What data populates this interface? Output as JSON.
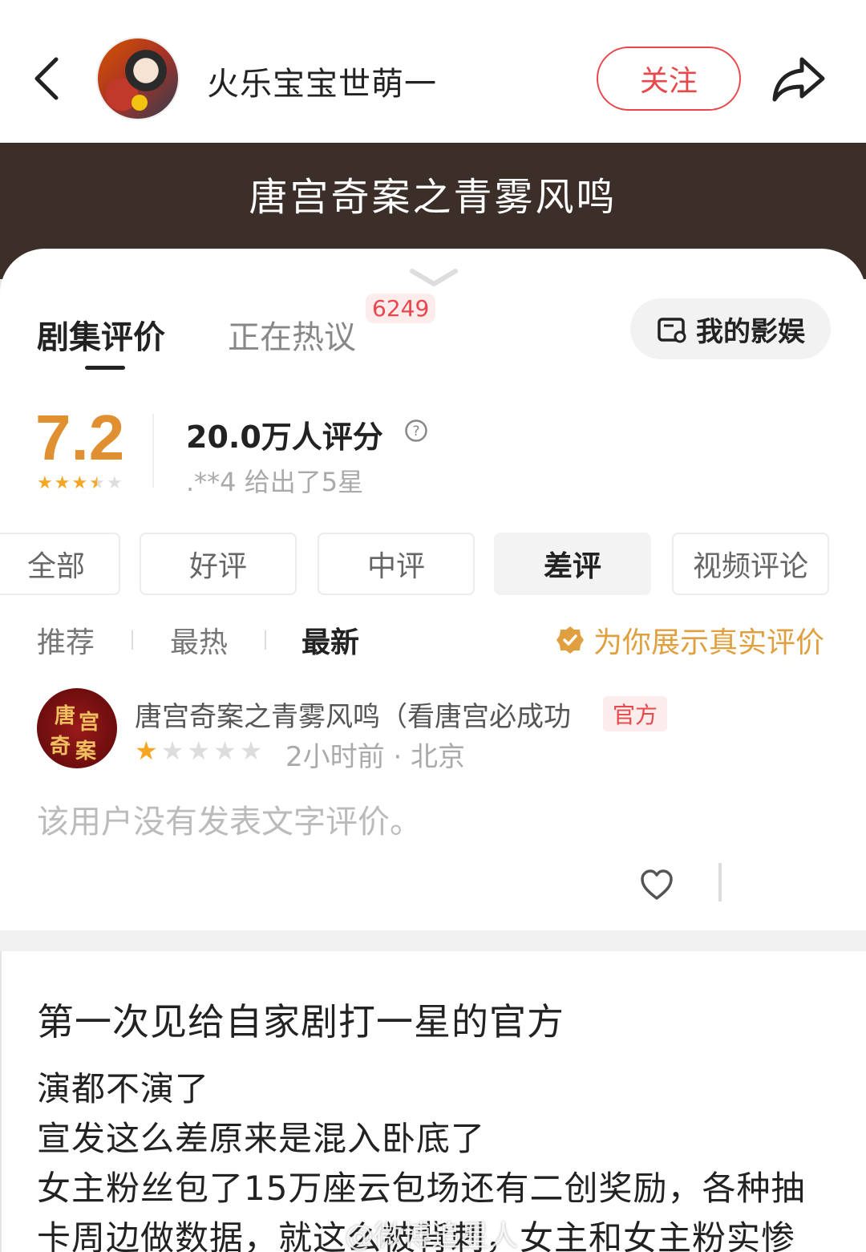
{
  "header": {
    "username": "火乐宝宝世萌一",
    "follow_label": "关注"
  },
  "banner": {
    "title": "唐宫奇案之青雾风鸣"
  },
  "tabs": {
    "reviews_label": "剧集评价",
    "hot_label": "正在热议",
    "hot_count": "6249",
    "my_entertainment_label": "我的影娱"
  },
  "rating": {
    "score": "7.2",
    "stars": 3.5,
    "count_label": "20.0万人评分",
    "recent_text": ".**4 给出了5星"
  },
  "filters": [
    "全部",
    "好评",
    "中评",
    "差评",
    "视频评论"
  ],
  "filter_active": "差评",
  "sort": {
    "items": [
      "推荐",
      "最热",
      "最新"
    ],
    "active": "最新",
    "verified_label": "为你展示真实评价"
  },
  "review": {
    "avatar_text": [
      "唐",
      "宫",
      "奇",
      "案"
    ],
    "name": "唐宫奇案之青雾风鸣（看唐宫必成功",
    "tag": "官方",
    "stars": 1,
    "meta": "2小时前 · 北京",
    "text": "该用户没有发表文字评价。"
  },
  "post": {
    "title": "第一次见给自家剧打一星的官方",
    "lines": [
      "演都不演了",
      "宣发这么差原来是混入卧底了",
      "女主粉丝包了15万座云包场还有二创奖励，各种抽",
      "卡周边做数据，就这么被背刺，女主和女主粉实惨"
    ],
    "watermark": "@微博追星人"
  },
  "colors": {
    "accent": "#e8474c",
    "score": "#e09030",
    "banner_bg": "#3c2f2a",
    "star_on": "#f5a623",
    "star_off": "#dddddd"
  }
}
